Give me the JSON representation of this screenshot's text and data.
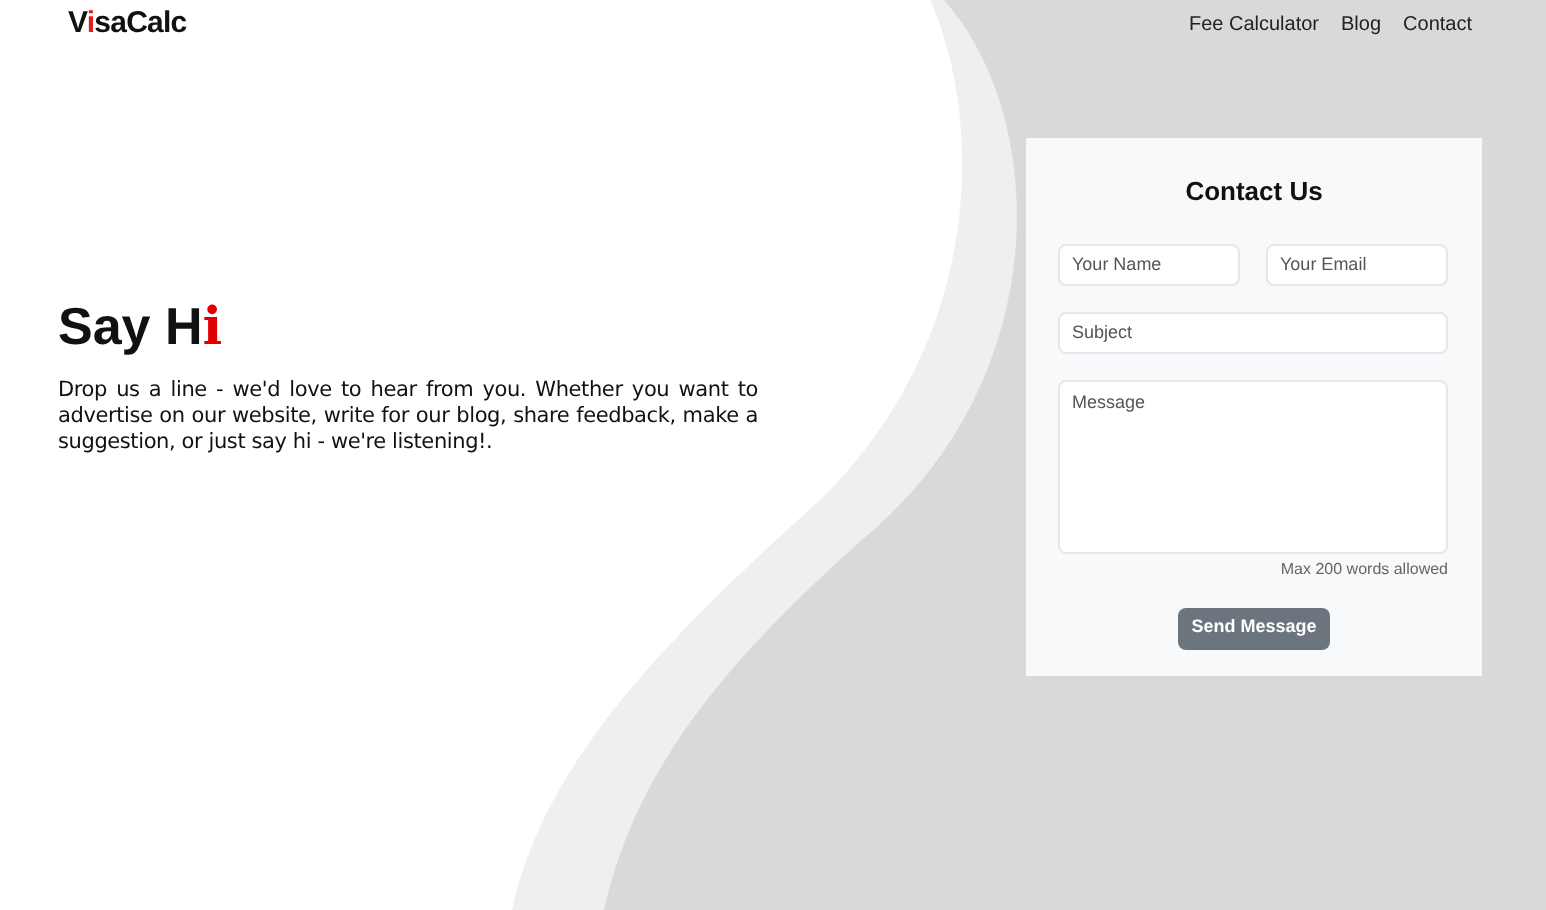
{
  "logo": {
    "parts": [
      {
        "text": "V",
        "accent": false
      },
      {
        "text": "i",
        "accent": true
      },
      {
        "text": "saCalc",
        "accent": false
      }
    ]
  },
  "nav": [
    "Fee Calculator",
    "Blog",
    "Contact"
  ],
  "hero": {
    "heading": [
      {
        "text": "Say H",
        "accent": false
      },
      {
        "text": "i",
        "accent": true
      }
    ],
    "text": "Drop us a line - we'd love to hear from you. Whether you want to advertise on our website, write for our blog, share feedback, make a suggestion, or just say hi - we're listening!."
  },
  "form": {
    "title": "Contact Us",
    "name": {
      "placeholder": "Your Name"
    },
    "email": {
      "placeholder": "Your Email"
    },
    "subject": {
      "placeholder": "Subject"
    },
    "message": {
      "placeholder": "Message"
    },
    "hint": "Max 200 words allowed",
    "button": "Send Message"
  }
}
